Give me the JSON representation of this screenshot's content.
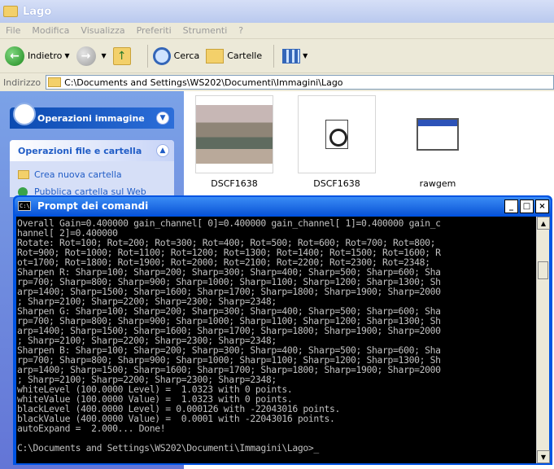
{
  "explorer": {
    "title": "Lago",
    "menu": [
      "File",
      "Modifica",
      "Visualizza",
      "Preferiti",
      "Strumenti",
      "?"
    ],
    "toolbar": {
      "back": "Indietro",
      "search": "Cerca",
      "folders": "Cartelle"
    },
    "address": {
      "label": "Indirizzo",
      "path": "C:\\Documents and Settings\\WS202\\Documenti\\Immagini\\Lago"
    },
    "taskpane": {
      "panel1": "Operazioni immagine",
      "panel2": "Operazioni file e cartella",
      "items": [
        "Crea nuova cartella",
        "Pubblica cartella sul Web"
      ]
    },
    "files": [
      {
        "name": "DSCF1638",
        "icon": "photo-thumbnail"
      },
      {
        "name": "DSCF1638",
        "icon": "document-icon"
      },
      {
        "name": "rawgem",
        "icon": "window-app-icon"
      }
    ]
  },
  "console": {
    "title": "Prompt dei comandi",
    "buttons": {
      "minimize": "_",
      "maximize": "□",
      "close": "×"
    },
    "lines": [
      "Overall Gain=0.400000 gain_channel[ 0]=0.400000 gain_channel[ 1]=0.400000 gain_c",
      "hannel[ 2]=0.400000",
      "Rotate: Rot=100; Rot=200; Rot=300; Rot=400; Rot=500; Rot=600; Rot=700; Rot=800;",
      "Rot=900; Rot=1000; Rot=1100; Rot=1200; Rot=1300; Rot=1400; Rot=1500; Rot=1600; R",
      "ot=1700; Rot=1800; Rot=1900; Rot=2000; Rot=2100; Rot=2200; Rot=2300; Rot=2348;",
      "Sharpen R: Sharp=100; Sharp=200; Sharp=300; Sharp=400; Sharp=500; Sharp=600; Sha",
      "rp=700; Sharp=800; Sharp=900; Sharp=1000; Sharp=1100; Sharp=1200; Sharp=1300; Sh",
      "arp=1400; Sharp=1500; Sharp=1600; Sharp=1700; Sharp=1800; Sharp=1900; Sharp=2000",
      "; Sharp=2100; Sharp=2200; Sharp=2300; Sharp=2348;",
      "Sharpen G: Sharp=100; Sharp=200; Sharp=300; Sharp=400; Sharp=500; Sharp=600; Sha",
      "rp=700; Sharp=800; Sharp=900; Sharp=1000; Sharp=1100; Sharp=1200; Sharp=1300; Sh",
      "arp=1400; Sharp=1500; Sharp=1600; Sharp=1700; Sharp=1800; Sharp=1900; Sharp=2000",
      "; Sharp=2100; Sharp=2200; Sharp=2300; Sharp=2348;",
      "Sharpen B: Sharp=100; Sharp=200; Sharp=300; Sharp=400; Sharp=500; Sharp=600; Sha",
      "rp=700; Sharp=800; Sharp=900; Sharp=1000; Sharp=1100; Sharp=1200; Sharp=1300; Sh",
      "arp=1400; Sharp=1500; Sharp=1600; Sharp=1700; Sharp=1800; Sharp=1900; Sharp=2000",
      "; Sharp=2100; Sharp=2200; Sharp=2300; Sharp=2348;",
      "whiteLevel (100.0000 Level) =  1.0323 with 0 points.",
      "whiteValue (100.0000 Value) =  1.0323 with 0 points.",
      "blackLevel (400.0000 Level) = 0.000126 with -22043016 points.",
      "blackValue (400.0000 Value) =  0.0001 with -22043016 points.",
      "autoExpand =  2.000... Done!",
      "",
      "C:\\Documents and Settings\\WS202\\Documenti\\Immagini\\Lago>_"
    ]
  }
}
